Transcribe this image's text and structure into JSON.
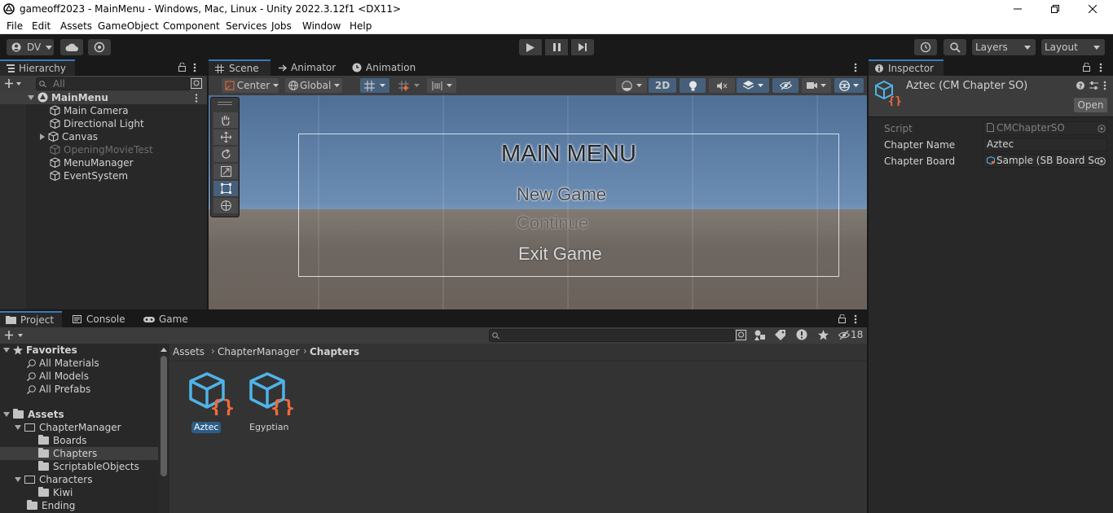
{
  "window": {
    "title": "gameoff2023 - MainMenu - Windows, Mac, Linux - Unity 2022.3.12f1 <DX11>"
  },
  "menubar": [
    "File",
    "Edit",
    "Assets",
    "GameObject",
    "Component",
    "Services",
    "Jobs",
    "Window",
    "Help"
  ],
  "toolbar": {
    "account_label": "DV",
    "layers_label": "Layers",
    "layout_label": "Layout"
  },
  "hierarchy": {
    "tab_label": "Hierarchy",
    "search_placeholder": "All",
    "scene_name": "MainMenu",
    "items": [
      "Main Camera",
      "Directional Light",
      "Canvas",
      "OpeningMovieTest",
      "MenuManager",
      "EventSystem"
    ]
  },
  "scene_tabs": [
    "Scene",
    "Animator",
    "Animation"
  ],
  "scene_toolbar": {
    "pivot_label": "Center",
    "space_label": "Global",
    "mode_2d_label": "2D"
  },
  "scene_view": {
    "menu_title": "MAIN MENU",
    "buttons": [
      "New Game",
      "Continue",
      "Exit Game"
    ]
  },
  "inspector": {
    "tab_label": "Inspector",
    "object_title": "Aztec (CM Chapter SO)",
    "open_button": "Open",
    "fields": [
      {
        "label": "Script",
        "value": "CMChapterSO"
      },
      {
        "label": "Chapter Name",
        "value": "Aztec"
      },
      {
        "label": "Chapter Board",
        "value": "Sample (SB Board Sc"
      }
    ]
  },
  "bottom_tabs": [
    "Project",
    "Console",
    "Game"
  ],
  "project": {
    "hidden_count": "18",
    "favorites_label": "Favorites",
    "favorites": [
      "All Materials",
      "All Models",
      "All Prefabs"
    ],
    "assets_label": "Assets",
    "tree": [
      "ChapterManager",
      "Boards",
      "Chapters",
      "ScriptableObjects",
      "Characters",
      "Kiwi",
      "Ending"
    ],
    "breadcrumb": [
      "Assets",
      "ChapterManager",
      "Chapters"
    ],
    "files": [
      "Aztec",
      "Egyptian"
    ]
  },
  "colors": {
    "accent": "#3a79bb",
    "panel": "#282828",
    "script_icon_blue": "#4fb3e8",
    "script_icon_orange": "#ef6b3a"
  }
}
